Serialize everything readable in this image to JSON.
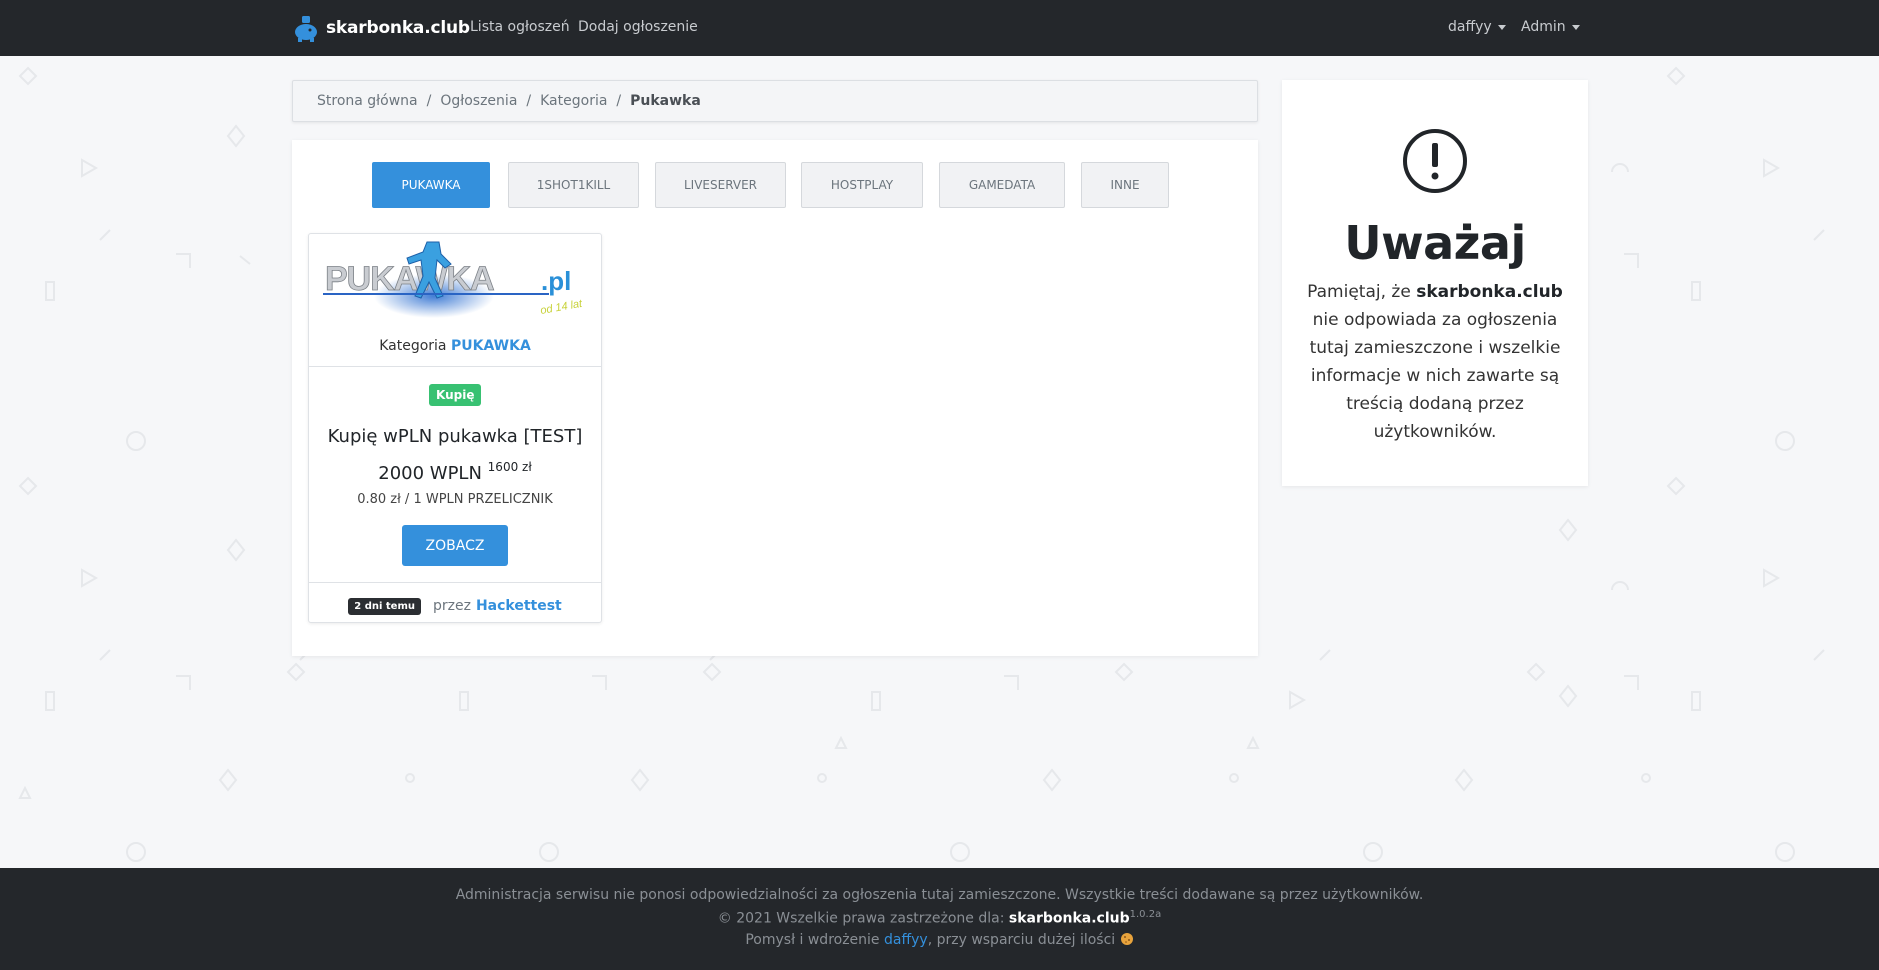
{
  "navbar": {
    "brand": "skarbonka.club",
    "links": [
      "Lista ogłoszeń",
      "Dodaj ogłoszenie"
    ],
    "user_menu": "daffyy",
    "admin_menu": "Admin"
  },
  "breadcrumb": {
    "items": [
      "Strona główna",
      "Ogłoszenia",
      "Kategoria"
    ],
    "active": "Pukawka"
  },
  "tabs": [
    "PUKAWKA",
    "1SHOT1KILL",
    "LIVESERVER",
    "HOSTPLAY",
    "GAMEDATA",
    "INNE"
  ],
  "active_tab": "PUKAWKA",
  "listing": {
    "logo_text": "PUKAWKA",
    "logo_suffix": ".pl",
    "logo_sub": "od 14 lat",
    "category_label": "Kategoria",
    "category_value": "PUKAWKA",
    "badge": "Kupię",
    "title": "Kupię wPLN pukawka [TEST]",
    "price": "2000 WPLN",
    "price_pln": "1600 zł",
    "rate": "0.80 zł / 1 WPLN PRZELICZNIK",
    "button": "ZOBACZ",
    "time_ago": "2 dni temu",
    "by_label": "przez",
    "author": "Hackettest"
  },
  "warning": {
    "title": "Uważaj",
    "text_before": "Pamiętaj, że",
    "site": "skarbonka.club",
    "text_after": "nie odpowiada za ogłoszenia tutaj zamieszczone i wszelkie informacje w nich zawarte są treścią dodaną przez użytkowników."
  },
  "footer": {
    "disclaimer": "Administracja serwisu nie ponosi odpowiedzialności za ogłoszenia tutaj zamieszczone. Wszystkie treści dodawane są przez użytkowników.",
    "copyright": "© 2021 Wszelkie prawa zastrzeżone dla:",
    "site": "skarbonka.club",
    "version": "1.0.2a",
    "idea_before": "Pomysł i wdrożenie",
    "idea_author": "daffyy",
    "idea_after": ", przy wsparciu dużej ilości"
  },
  "colors": {
    "accent": "#3490dc",
    "success": "#38c172",
    "nav_bg": "#24272b"
  }
}
